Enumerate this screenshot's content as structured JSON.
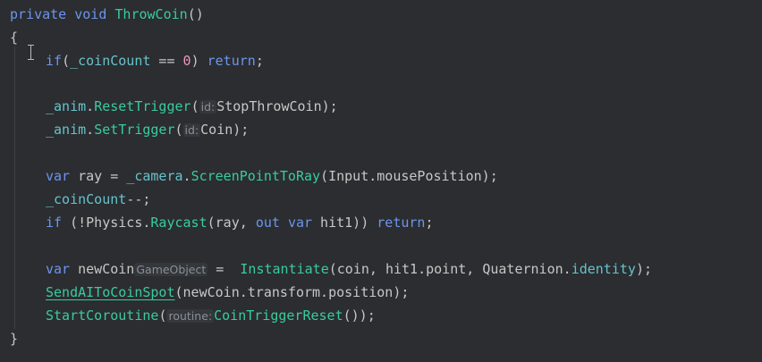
{
  "code": {
    "signature": {
      "modifier": "private",
      "type": "void",
      "name": "ThrowCoin",
      "parens": "()"
    },
    "open_brace": "{",
    "close_brace": "}",
    "l1": {
      "kw_if": "if",
      "open": "(",
      "field": "_coinCount",
      "op": " == ",
      "num": "0",
      "close": ") ",
      "kw_return": "return",
      "end": ";"
    },
    "l2": {
      "field": "_anim",
      "dot": ".",
      "method": "ResetTrigger",
      "open": "(",
      "hint": "id:",
      "arg": "StopThrowCoin",
      "end": ");"
    },
    "l3": {
      "field": "_anim",
      "dot": ".",
      "method": "SetTrigger",
      "open": "(",
      "hint": "id:",
      "arg": "Coin",
      "end": ");"
    },
    "l4": {
      "kw_var": "var",
      "var_name": " ray = ",
      "field": "_camera",
      "dot": ".",
      "method": "ScreenPointToRay",
      "args": "(Input.mousePosition);"
    },
    "l5": {
      "field": "_coinCount",
      "rest": "--;"
    },
    "l6": {
      "kw_if": "if",
      "part1": " (!Physics.",
      "method": "Raycast",
      "part2": "(ray, ",
      "kw_out": "out",
      "sp": " ",
      "kw_var": "var",
      "part3": " hit1)) ",
      "kw_return": "return",
      "end": ";"
    },
    "l7": {
      "kw_var": "var",
      "var_name": " newCoin",
      "hint": "GameObject",
      "eq": " =  ",
      "method": "Instantiate",
      "args": "(coin, hit1.point, Quaternion.",
      "prop": "identity",
      "end": ");"
    },
    "l8": {
      "method": "SendAIToCoinSpot",
      "args": "(newCoin.transform.position);"
    },
    "l9": {
      "method": "StartCoroutine",
      "open": "(",
      "hint": "routine:",
      "arg": "CoinTriggerReset",
      "end": "());"
    }
  }
}
